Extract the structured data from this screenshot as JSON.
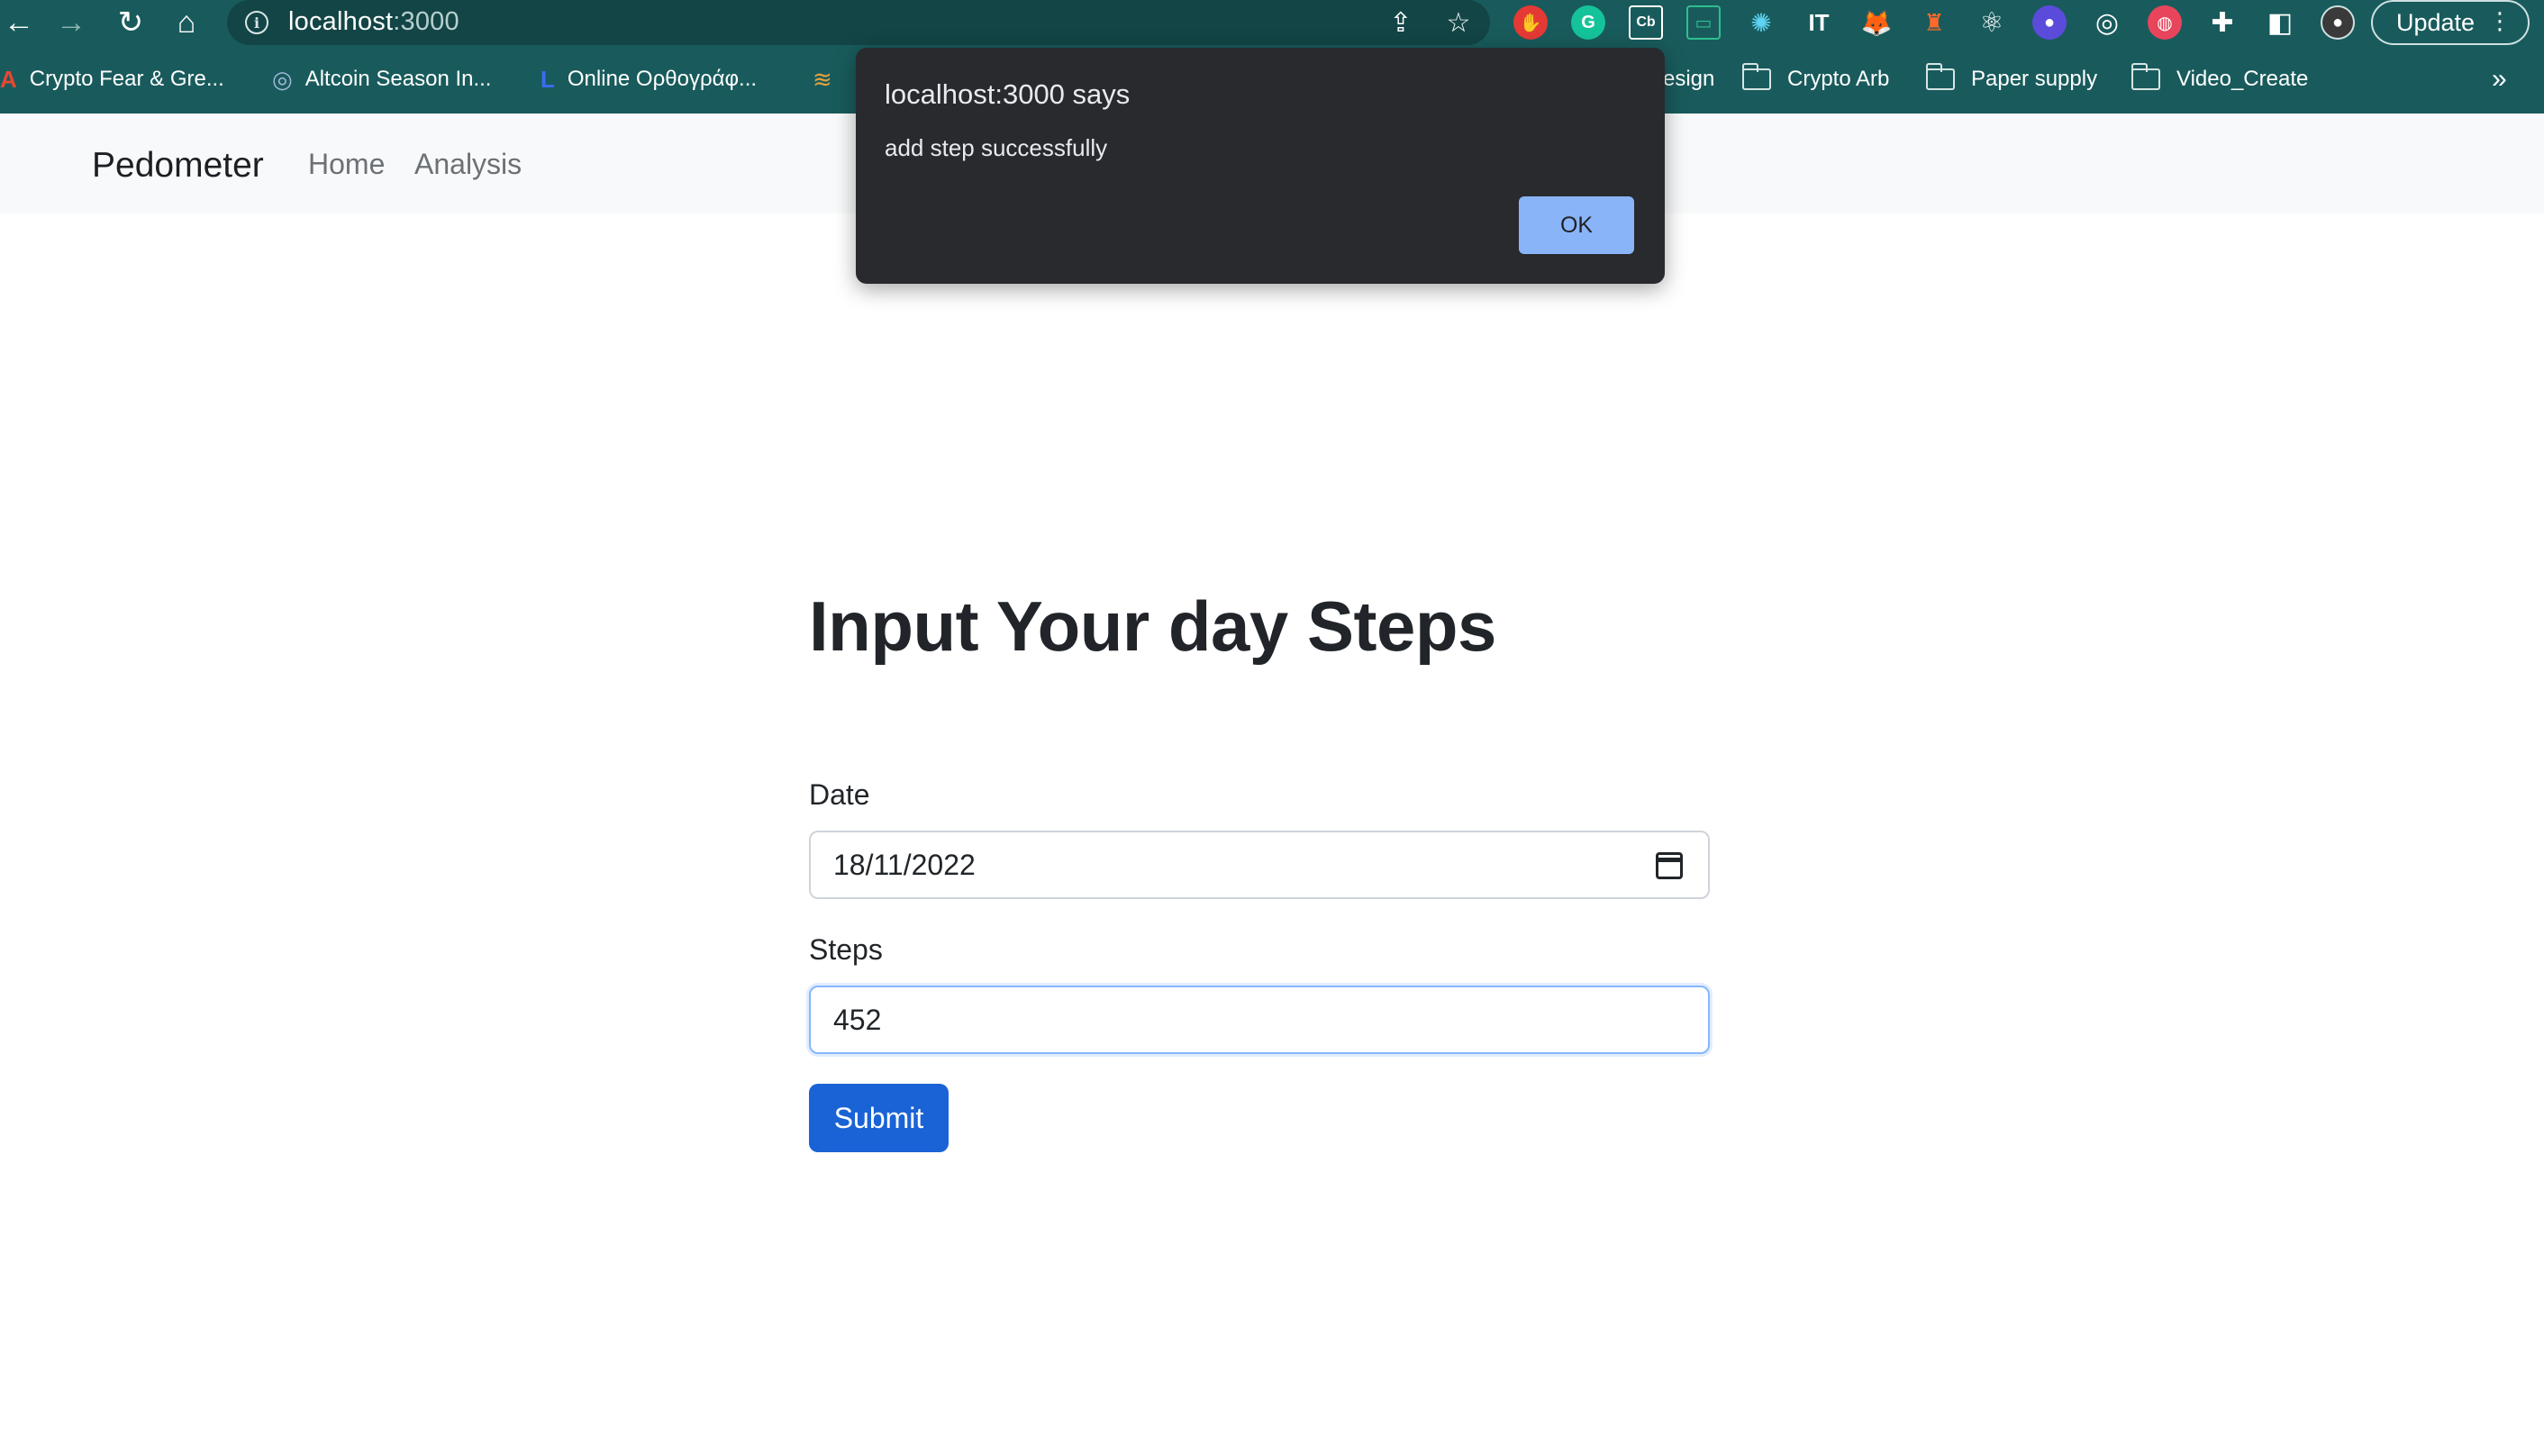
{
  "browser": {
    "url_host": "localhost",
    "url_port": ":3000",
    "update_label": "Update",
    "bookmarks": [
      {
        "label": "Crypto Fear & Gre...",
        "icon": "A"
      },
      {
        "label": "Altcoin Season In...",
        "icon": "◎"
      },
      {
        "label": "Online Ορθογράφ...",
        "icon": "L"
      },
      {
        "label": "esign",
        "icon": ""
      },
      {
        "label": "Crypto Arb",
        "icon": "folder"
      },
      {
        "label": "Paper supply",
        "icon": "folder"
      },
      {
        "label": "Video_Create",
        "icon": "folder"
      }
    ],
    "more_bookmarks": "»"
  },
  "navbar": {
    "brand": "Pedometer",
    "links": [
      "Home",
      "Analysis"
    ]
  },
  "form": {
    "heading": "Input Your day Steps",
    "date_label": "Date",
    "date_value": "18/11/2022",
    "steps_label": "Steps",
    "steps_value": "452",
    "submit_label": "Submit"
  },
  "dialog": {
    "title": "localhost:3000 says",
    "message": "add step successfully",
    "ok_label": "OK"
  },
  "colors": {
    "browser_frame": "#195b5c",
    "primary_button": "#1a63d6",
    "dialog_bg": "#292a2d",
    "dialog_ok": "#8ab4f8"
  }
}
